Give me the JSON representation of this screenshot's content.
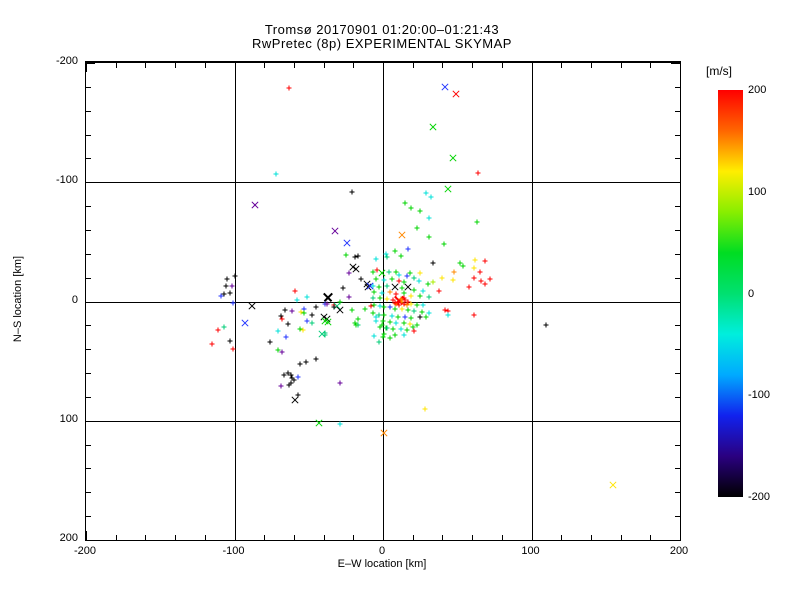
{
  "chart_data": {
    "type": "scatter",
    "title": "Tromsø 20170901 01:20:00–01:21:43",
    "subtitle": "RwPretec (8p) EXPERIMENTAL SKYMAP",
    "xlabel": "E–W location [km]",
    "ylabel": "N–S location [km]",
    "xlim": [
      -200,
      200
    ],
    "ylim": [
      -200,
      200
    ],
    "grid": true,
    "grid_values": [
      -100,
      0,
      100
    ],
    "xtick_labels": [
      "-200",
      "-100",
      "0",
      "100",
      "200"
    ],
    "ytick_labels": [
      "200",
      "100",
      "0",
      "-100",
      "-200"
    ],
    "xticks_major": [
      -200,
      -100,
      0,
      100,
      200
    ],
    "yticks_major": [
      -200,
      -100,
      0,
      100,
      200
    ],
    "minor_tick_step": 20,
    "colorbar": {
      "label": "[m/s]",
      "tick_labels": [
        "200",
        "100",
        "0",
        "-100",
        "-200"
      ],
      "ticks": [
        200,
        100,
        0,
        -100,
        -200
      ],
      "stops": [
        "#ff0000",
        "#ff6600",
        "#ffee00",
        "#88ee00",
        "#00dd22",
        "#00e070",
        "#00eedd",
        "#00aaff",
        "#1122ee",
        "#2a0080",
        "#000000"
      ]
    },
    "palette": {
      "r": "#ff0000",
      "o": "#ff8800",
      "y": "#ffe400",
      "l": "#aaee00",
      "g": "#00d400",
      "t": "#00cc77",
      "c": "#00e0d8",
      "b": "#2233ff",
      "p": "#660099",
      "k": "#000000"
    },
    "marker_legend": {
      "+": "small plus",
      "x": "cross",
      "X": "large cross"
    },
    "points": [
      [
        -63,
        179,
        "r",
        "+"
      ],
      [
        42,
        180,
        "b",
        "x"
      ],
      [
        49,
        174,
        "r",
        "x"
      ],
      [
        34,
        146,
        "g",
        "x"
      ],
      [
        47,
        120,
        "g",
        "x"
      ],
      [
        -72,
        107,
        "c",
        "+"
      ],
      [
        64,
        108,
        "r",
        "+"
      ],
      [
        44,
        94,
        "g",
        "x"
      ],
      [
        -86,
        81,
        "p",
        "x"
      ],
      [
        -21,
        92,
        "k",
        "+"
      ],
      [
        29,
        91,
        "c",
        "+"
      ],
      [
        32,
        88,
        "c",
        "+"
      ],
      [
        15,
        83,
        "g",
        "+"
      ],
      [
        19,
        78,
        "g",
        "+"
      ],
      [
        25,
        76,
        "g",
        "+"
      ],
      [
        63,
        67,
        "g",
        "+"
      ],
      [
        31,
        70,
        "c",
        "+"
      ],
      [
        23,
        62,
        "g",
        "+"
      ],
      [
        -32,
        59,
        "p",
        "x"
      ],
      [
        13,
        56,
        "o",
        "x"
      ],
      [
        -24,
        49,
        "b",
        "x"
      ],
      [
        31,
        54,
        "g",
        "+"
      ],
      [
        41,
        48,
        "g",
        "+"
      ],
      [
        -25,
        39,
        "g",
        "+"
      ],
      [
        -19,
        37,
        "k",
        "+"
      ],
      [
        17,
        44,
        "b",
        "+"
      ],
      [
        3,
        37,
        "t",
        "+"
      ],
      [
        2,
        40,
        "c",
        "+"
      ],
      [
        8,
        42,
        "g",
        "+"
      ],
      [
        12,
        38,
        "g",
        "+"
      ],
      [
        -5,
        36,
        "c",
        "+"
      ],
      [
        -105,
        19,
        "k",
        "+"
      ],
      [
        -100,
        21,
        "k",
        "+"
      ],
      [
        -106,
        13,
        "k",
        "+"
      ],
      [
        -102,
        13,
        "p",
        "+"
      ],
      [
        -107,
        6,
        "k",
        "+"
      ],
      [
        -109,
        5,
        "b",
        "+"
      ],
      [
        -103,
        7,
        "k",
        "+"
      ],
      [
        -101,
        -1,
        "b",
        "+"
      ],
      [
        -88,
        -4,
        "k",
        "x"
      ],
      [
        -93,
        -18,
        "b",
        "x"
      ],
      [
        -107,
        -21,
        "t",
        "+"
      ],
      [
        -111,
        -24,
        "r",
        "+"
      ],
      [
        -115,
        -36,
        "r",
        "+"
      ],
      [
        -103,
        -33,
        "k",
        "+"
      ],
      [
        -101,
        -40,
        "r",
        "+"
      ],
      [
        -71,
        -41,
        "g",
        "+"
      ],
      [
        -68,
        -42,
        "p",
        "+"
      ],
      [
        -59,
        9,
        "r",
        "+"
      ],
      [
        -58,
        1,
        "c",
        "+"
      ],
      [
        -51,
        4,
        "c",
        "+"
      ],
      [
        -53,
        -6,
        "b",
        "+"
      ],
      [
        -66,
        -7,
        "k",
        "+"
      ],
      [
        -61,
        -8,
        "p",
        "+"
      ],
      [
        -55,
        -9,
        "y",
        "+"
      ],
      [
        -53,
        -10,
        "g",
        "+"
      ],
      [
        -48,
        -11,
        "k",
        "+"
      ],
      [
        -45,
        -5,
        "k",
        "+"
      ],
      [
        -51,
        -16,
        "b",
        "+"
      ],
      [
        -48,
        -18,
        "t",
        "+"
      ],
      [
        -69,
        -12,
        "k",
        "+"
      ],
      [
        -64,
        -19,
        "k",
        "+"
      ],
      [
        -68,
        -15,
        "r",
        "+"
      ],
      [
        -71,
        -25,
        "c",
        "+"
      ],
      [
        -56,
        -23,
        "g",
        "+"
      ],
      [
        -54,
        -24,
        "y",
        "+"
      ],
      [
        -76,
        -34,
        "k",
        "+"
      ],
      [
        -65,
        -30,
        "b",
        "+"
      ],
      [
        -37,
        4,
        "k",
        "X"
      ],
      [
        -38,
        -15,
        "k",
        "x"
      ],
      [
        -37,
        -17,
        "g",
        "x"
      ],
      [
        -39,
        -26,
        "t",
        "+"
      ],
      [
        -39,
        -2,
        "b",
        "+"
      ],
      [
        -33,
        -3,
        "r",
        "+"
      ],
      [
        -45,
        -48,
        "k",
        "+"
      ],
      [
        -56,
        -52,
        "k",
        "+"
      ],
      [
        -52,
        -51,
        "k",
        "+"
      ],
      [
        -64,
        -60,
        "k",
        "+"
      ],
      [
        -62,
        -62,
        "k",
        "+"
      ],
      [
        -61,
        -64,
        "k",
        "+"
      ],
      [
        -60,
        -66,
        "k",
        "+"
      ],
      [
        -62,
        -68,
        "k",
        "+"
      ],
      [
        -63,
        -70,
        "k",
        "+"
      ],
      [
        -57,
        -63,
        "b",
        "+"
      ],
      [
        -67,
        -62,
        "k",
        "+"
      ],
      [
        -69,
        -71,
        "p",
        "+"
      ],
      [
        -29,
        -68,
        "p",
        "+"
      ],
      [
        -59,
        -83,
        "k",
        "x"
      ],
      [
        -57,
        -78,
        "k",
        "+"
      ],
      [
        -43,
        -102,
        "g",
        "x"
      ],
      [
        -29,
        -103,
        "c",
        "+"
      ],
      [
        1,
        -110,
        "o",
        "x"
      ],
      [
        28,
        -90,
        "y",
        "+"
      ],
      [
        155,
        -154,
        "y",
        "x"
      ],
      [
        110,
        -20,
        "k",
        "+"
      ],
      [
        -17,
        38,
        "k",
        "+"
      ],
      [
        -20,
        29,
        "k",
        "x"
      ],
      [
        -18,
        27,
        "k",
        "x"
      ],
      [
        -23,
        24,
        "p",
        "+"
      ],
      [
        -15,
        19,
        "k",
        "+"
      ],
      [
        -11,
        15,
        "k",
        "x"
      ],
      [
        -10,
        12,
        "k",
        "x"
      ],
      [
        -7,
        13,
        "c",
        "+"
      ],
      [
        -27,
        11,
        "k",
        "+"
      ],
      [
        -23,
        4,
        "p",
        "+"
      ],
      [
        -29,
        0,
        "g",
        "+"
      ],
      [
        -31,
        -4,
        "t",
        "x"
      ],
      [
        -17,
        -15,
        "g",
        "+"
      ],
      [
        -38,
        -2,
        "p",
        "+"
      ],
      [
        -33,
        -5,
        "k",
        "+"
      ],
      [
        -29,
        -7,
        "k",
        "x"
      ],
      [
        -21,
        -7,
        "g",
        "+"
      ],
      [
        -12,
        -6,
        "g",
        "+"
      ],
      [
        -8,
        -4,
        "r",
        "+"
      ],
      [
        -40,
        -13,
        "k",
        "x"
      ],
      [
        -39,
        -16,
        "g",
        "x"
      ],
      [
        -19,
        -18,
        "g",
        "+"
      ],
      [
        -17,
        -20,
        "t",
        "+"
      ],
      [
        -41,
        -27,
        "t",
        "x"
      ],
      [
        -39,
        -28,
        "t",
        "+"
      ],
      [
        -5,
        -13,
        "c",
        "+"
      ],
      [
        -6,
        -29,
        "c",
        "+"
      ],
      [
        -3,
        -34,
        "t",
        "+"
      ],
      [
        -18,
        -20,
        "g",
        "+"
      ],
      [
        -1,
        -20,
        "g",
        "+"
      ],
      [
        2,
        -22,
        "g",
        "+"
      ],
      [
        20,
        -21,
        "g",
        "+"
      ],
      [
        34,
        32,
        "k",
        "+"
      ],
      [
        52,
        32,
        "g",
        "+"
      ],
      [
        54,
        30,
        "g",
        "+"
      ],
      [
        62,
        35,
        "y",
        "+"
      ],
      [
        69,
        34,
        "r",
        "+"
      ],
      [
        48,
        25,
        "o",
        "+"
      ],
      [
        61,
        28,
        "y",
        "+"
      ],
      [
        40,
        20,
        "y",
        "+"
      ],
      [
        34,
        16,
        "l",
        "+"
      ],
      [
        47,
        18,
        "y",
        "+"
      ],
      [
        65,
        25,
        "r",
        "+"
      ],
      [
        61,
        20,
        "r",
        "+"
      ],
      [
        66,
        17,
        "r",
        "+"
      ],
      [
        72,
        19,
        "r",
        "+"
      ],
      [
        69,
        15,
        "r",
        "+"
      ],
      [
        38,
        9,
        "r",
        "+"
      ],
      [
        58,
        12,
        "r",
        "+"
      ],
      [
        42,
        -7,
        "r",
        "+"
      ],
      [
        44,
        -8,
        "r",
        "+"
      ],
      [
        44,
        -11,
        "c",
        "+"
      ],
      [
        61,
        -11,
        "r",
        "+"
      ],
      [
        -7,
        25,
        "g",
        "+"
      ],
      [
        -4,
        26,
        "r",
        "+"
      ],
      [
        -1,
        24,
        "g",
        "x"
      ],
      [
        4,
        25,
        "t",
        "+"
      ],
      [
        9,
        25,
        "g",
        "+"
      ],
      [
        18,
        24,
        "g",
        "+"
      ],
      [
        25,
        24,
        "y",
        "+"
      ],
      [
        11,
        22,
        "c",
        "+"
      ],
      [
        16,
        21,
        "b",
        "+"
      ],
      [
        21,
        20,
        "t",
        "+"
      ],
      [
        -5,
        19,
        "g",
        "+"
      ],
      [
        1,
        18,
        "c",
        "+"
      ],
      [
        6,
        19,
        "g",
        "+"
      ],
      [
        11,
        17,
        "r",
        "+"
      ],
      [
        14,
        16,
        "g",
        "+"
      ],
      [
        24,
        17,
        "c",
        "+"
      ],
      [
        30,
        15,
        "g",
        "+"
      ],
      [
        -9,
        13,
        "b",
        "x"
      ],
      [
        -3,
        12,
        "g",
        "+"
      ],
      [
        3,
        13,
        "t",
        "+"
      ],
      [
        8,
        12,
        "k",
        "x"
      ],
      [
        17,
        12,
        "k",
        "x"
      ],
      [
        13,
        11,
        "g",
        "+"
      ],
      [
        21,
        10,
        "g",
        "+"
      ],
      [
        27,
        9,
        "c",
        "+"
      ],
      [
        -6,
        8,
        "g",
        "+"
      ],
      [
        -1,
        7,
        "c",
        "+"
      ],
      [
        5,
        8,
        "o",
        "+"
      ],
      [
        9,
        6,
        "r",
        "+"
      ],
      [
        14,
        7,
        "g",
        "+"
      ],
      [
        19,
        5,
        "y",
        "+"
      ],
      [
        25,
        5,
        "g",
        "+"
      ],
      [
        31,
        4,
        "t",
        "+"
      ],
      [
        -7,
        3,
        "t",
        "+"
      ],
      [
        -2,
        3,
        "g",
        "+"
      ],
      [
        3,
        2,
        "y",
        "+"
      ],
      [
        7,
        1,
        "r",
        "+"
      ],
      [
        11,
        1,
        "r",
        "X"
      ],
      [
        13,
        0,
        "o",
        "+"
      ],
      [
        15,
        1,
        "r",
        "+"
      ],
      [
        17,
        0,
        "r",
        "+"
      ],
      [
        9,
        -2,
        "o",
        "+"
      ],
      [
        11,
        -3,
        "r",
        "+"
      ],
      [
        14,
        -2,
        "r",
        "+"
      ],
      [
        16,
        -3,
        "o",
        "+"
      ],
      [
        19,
        -2,
        "y",
        "+"
      ],
      [
        23,
        -3,
        "g",
        "+"
      ],
      [
        27,
        -3,
        "c",
        "+"
      ],
      [
        -6,
        -3,
        "g",
        "+"
      ],
      [
        -2,
        -4,
        "c",
        "+"
      ],
      [
        1,
        -5,
        "g",
        "+"
      ],
      [
        5,
        -5,
        "b",
        "+"
      ],
      [
        8,
        -6,
        "g",
        "+"
      ],
      [
        13,
        -6,
        "y",
        "+"
      ],
      [
        17,
        -7,
        "g",
        "+"
      ],
      [
        21,
        -8,
        "t",
        "+"
      ],
      [
        26,
        -9,
        "g",
        "+"
      ],
      [
        31,
        -10,
        "c",
        "+"
      ],
      [
        -7,
        -10,
        "g",
        "+"
      ],
      [
        -3,
        -11,
        "t",
        "+"
      ],
      [
        1,
        -11,
        "g",
        "+"
      ],
      [
        6,
        -12,
        "c",
        "+"
      ],
      [
        10,
        -13,
        "g",
        "+"
      ],
      [
        15,
        -13,
        "b",
        "+"
      ],
      [
        19,
        -14,
        "g",
        "+"
      ],
      [
        25,
        -13,
        "k",
        "+"
      ],
      [
        29,
        -13,
        "g",
        "+"
      ],
      [
        -5,
        -16,
        "c",
        "+"
      ],
      [
        0,
        -16,
        "g",
        "+"
      ],
      [
        5,
        -17,
        "g",
        "+"
      ],
      [
        9,
        -18,
        "c",
        "+"
      ],
      [
        14,
        -18,
        "g",
        "+"
      ],
      [
        18,
        -19,
        "y",
        "+"
      ],
      [
        23,
        -20,
        "g",
        "+"
      ],
      [
        -2,
        -21,
        "g",
        "+"
      ],
      [
        3,
        -22,
        "t",
        "+"
      ],
      [
        7,
        -23,
        "g",
        "+"
      ],
      [
        12,
        -23,
        "c",
        "+"
      ],
      [
        16,
        -24,
        "g",
        "+"
      ],
      [
        21,
        -25,
        "r",
        "+"
      ],
      [
        1,
        -27,
        "g",
        "+"
      ],
      [
        8,
        -28,
        "g",
        "+"
      ],
      [
        14,
        -28,
        "c",
        "+"
      ],
      [
        10,
        0,
        "r",
        "+"
      ],
      [
        12,
        2,
        "o",
        "+"
      ],
      [
        14,
        3,
        "r",
        "+"
      ],
      [
        8,
        -1,
        "r",
        "+"
      ],
      [
        0,
        -30,
        "g",
        "+"
      ],
      [
        5,
        -31,
        "g",
        "+"
      ]
    ]
  }
}
